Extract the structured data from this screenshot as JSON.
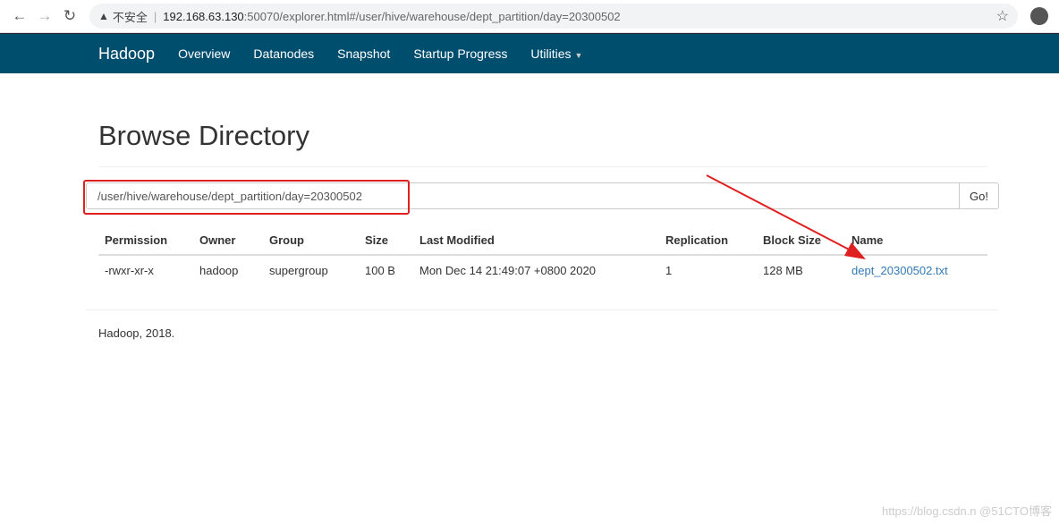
{
  "browser": {
    "security_label": "不安全",
    "url_host": "192.168.63.130",
    "url_rest": ":50070/explorer.html#/user/hive/warehouse/dept_partition/day=20300502"
  },
  "navbar": {
    "brand": "Hadoop",
    "items": [
      "Overview",
      "Datanodes",
      "Snapshot",
      "Startup Progress",
      "Utilities"
    ]
  },
  "page": {
    "title": "Browse Directory",
    "path_value": "/user/hive/warehouse/dept_partition/day=20300502",
    "go_label": "Go!"
  },
  "table": {
    "headers": [
      "Permission",
      "Owner",
      "Group",
      "Size",
      "Last Modified",
      "Replication",
      "Block Size",
      "Name"
    ],
    "rows": [
      [
        "-rwxr-xr-x",
        "hadoop",
        "supergroup",
        "100 B",
        "Mon Dec 14 21:49:07 +0800 2020",
        "1",
        "128 MB",
        "dept_20300502.txt"
      ]
    ]
  },
  "footer": "Hadoop, 2018.",
  "watermark": "https://blog.csdn.n @51CTO博客",
  "colors": {
    "navbar": "#004e6e",
    "link": "#337ab7",
    "annotation": "#e02020"
  }
}
